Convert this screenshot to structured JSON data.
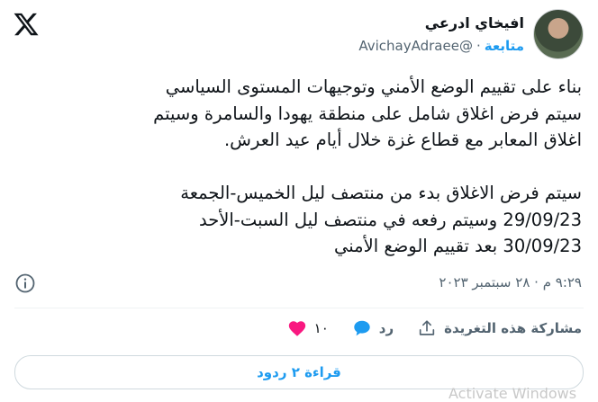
{
  "header": {
    "display_name": "افيخاي ادرعي",
    "handle": "@AvichayAdraee",
    "separator": "·",
    "follow_label": "متابعة"
  },
  "tweet": {
    "text": "بناء على تقييم الوضع الأمني وتوجيهات المستوى السياسي\nسيتم فرض اغلاق شامل على منطقة يهودا والسامرة وسيتم\nاغلاق المعابر مع قطاع غزة خلال أيام عيد العرش.\n\nسيتم فرض الاغلاق بدء من منتصف ليل الخميس-الجمعة\n29/09/23 وسيتم رفعه في منتصف ليل السبت-الأحد\n30/09/23 بعد تقييم الوضع الأمني",
    "timestamp": "٩:٢٩ م · ٢٨ سبتمبر ٢٠٢٣"
  },
  "actions": {
    "like_count": "١٠",
    "reply_label": "رد",
    "share_label": "مشاركة هذه التغريدة"
  },
  "replies_button": {
    "label": "قراءة ٢ ردود"
  },
  "watermark": {
    "text": "Activate Windows"
  },
  "icons": {
    "brand": "x-logo-icon",
    "info": "info-icon",
    "like": "heart-icon",
    "reply": "speech-bubble-icon",
    "share": "share-upload-icon"
  },
  "colors": {
    "accent": "#1d9bf0",
    "like": "#f91880",
    "text": "#0f1419",
    "muted": "#536471"
  }
}
